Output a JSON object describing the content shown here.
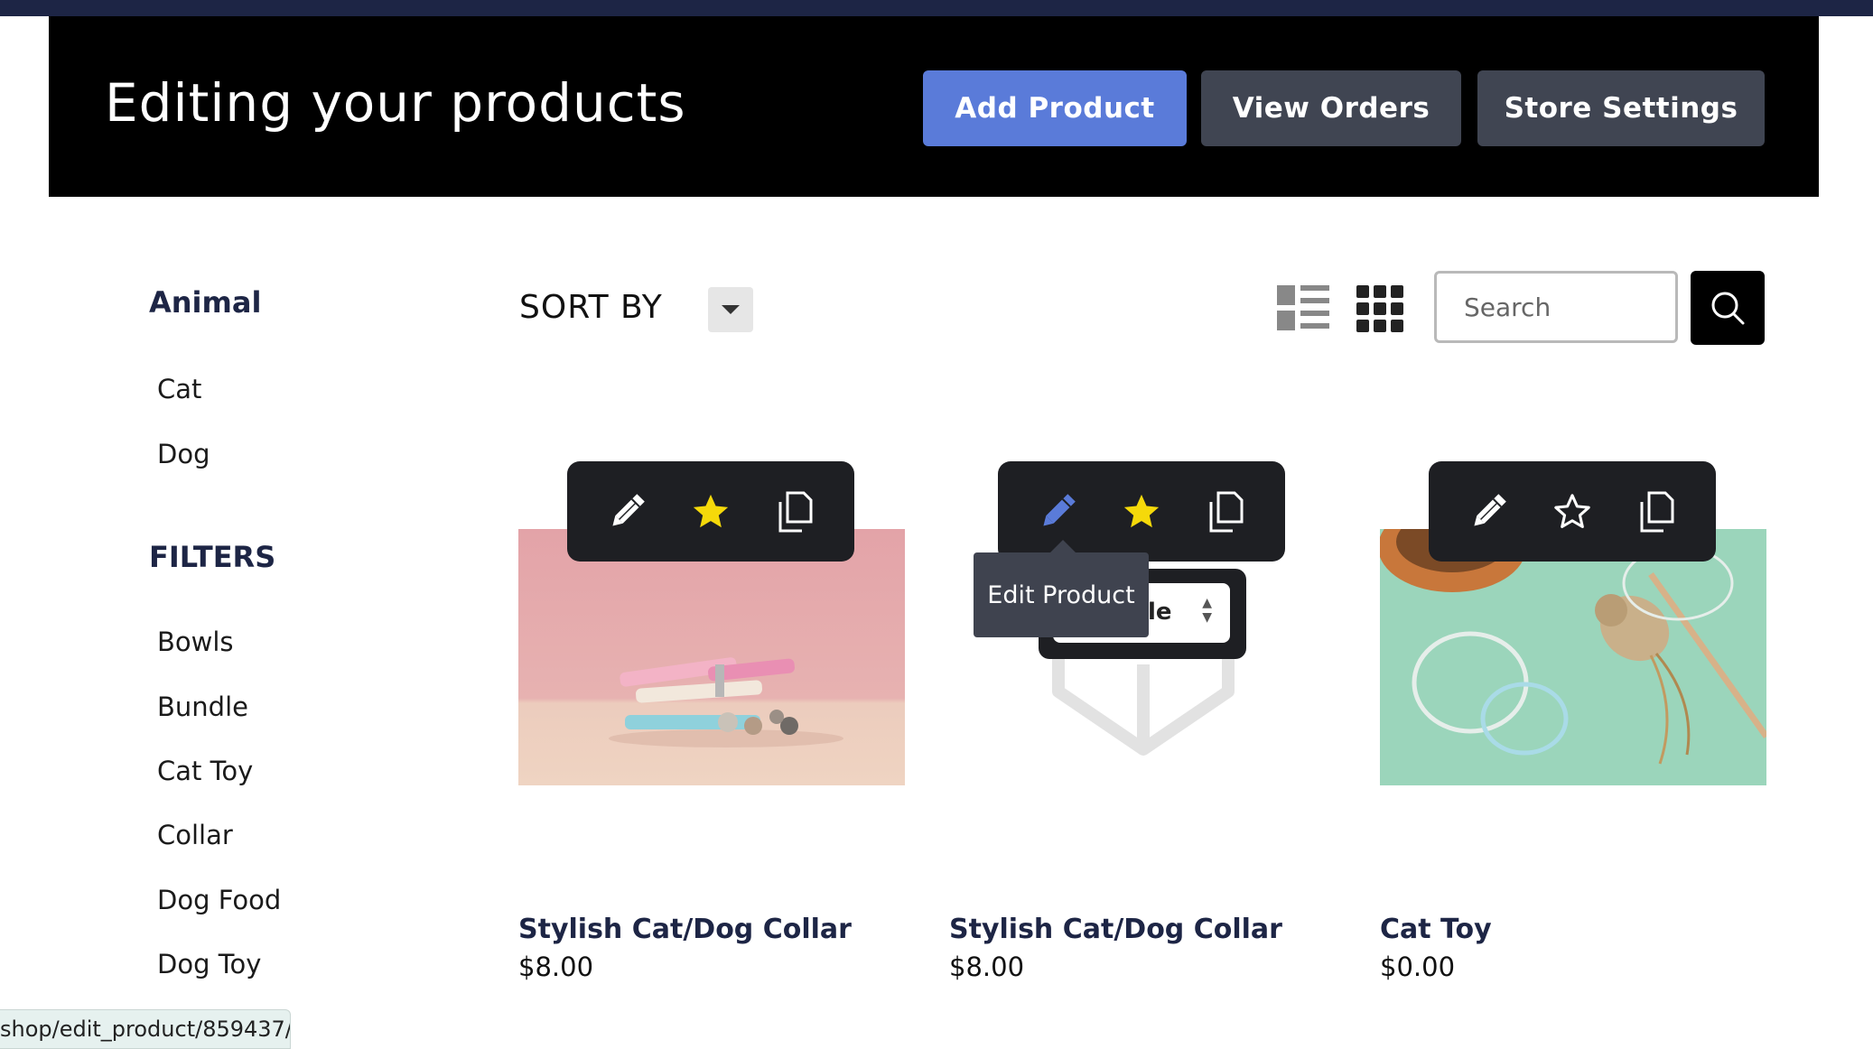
{
  "header": {
    "title": "Editing your products",
    "add_label": "Add Product",
    "orders_label": "View Orders",
    "settings_label": "Store Settings"
  },
  "sidebar": {
    "animal_heading": "Animal",
    "animals": [
      "Cat",
      "Dog"
    ],
    "filters_heading": "FILTERS",
    "filters": [
      "Bowls",
      "Bundle",
      "Cat Toy",
      "Collar",
      "Dog Food",
      "Dog Toy"
    ]
  },
  "toolbar": {
    "sort_label": "SORT BY",
    "search_placeholder": "Search"
  },
  "products": [
    {
      "name": "Stylish Cat/Dog Collar",
      "price": "$8.00",
      "featured": true
    },
    {
      "name": "Stylish Cat/Dog Collar",
      "price": "$8.00",
      "featured": true
    },
    {
      "name": "Cat Toy",
      "price": "$0.00",
      "featured": false
    }
  ],
  "tooltip": "Edit Product",
  "visibility_select_fragment": "le",
  "status_url": "shop/edit_product/859437/",
  "colors": {
    "accent": "#5a7bd9",
    "header_bg": "#000000",
    "topstrip": "#1d2545",
    "star": "#f5d90a",
    "navy_text": "#1d2545"
  },
  "icons": [
    "pencil-icon",
    "star-icon",
    "copy-icon",
    "list-view-icon",
    "grid-view-icon",
    "search-icon",
    "caret-down-icon"
  ]
}
